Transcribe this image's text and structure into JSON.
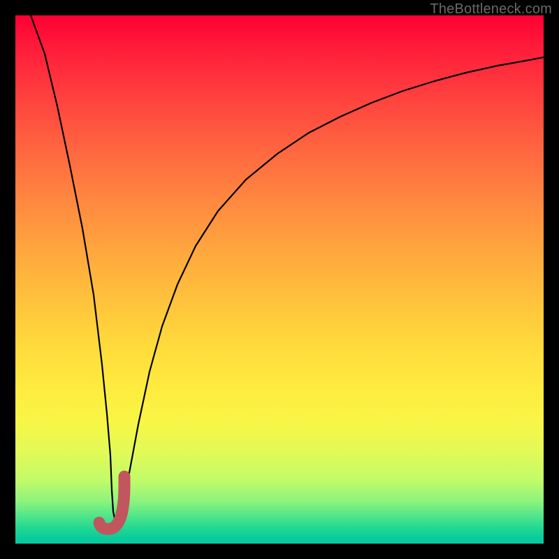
{
  "attribution": "TheBottleneck.com",
  "colors": {
    "frame": "#000000",
    "curve_stroke": "#000000",
    "marker_fill": "#c1565e",
    "gradient_top": "#ff0033",
    "gradient_bottom": "#07c9a1"
  },
  "chart_data": {
    "type": "line",
    "title": "",
    "xlabel": "",
    "ylabel": "",
    "xlim": [
      0,
      100
    ],
    "ylim": [
      0,
      100
    ],
    "grid": false,
    "legend": false,
    "series": [
      {
        "name": "curve",
        "x": [
          3,
          4,
          6,
          8,
          10,
          12,
          14,
          15,
          16,
          17,
          18,
          19,
          20,
          22,
          24,
          26,
          28,
          30,
          33,
          36,
          40,
          45,
          50,
          55,
          60,
          65,
          70,
          75,
          80,
          85,
          90,
          95,
          100
        ],
        "values": [
          100,
          92,
          79,
          66,
          54,
          41,
          28,
          22,
          15,
          8,
          4,
          2.5,
          4,
          12,
          22,
          32,
          41,
          48,
          57,
          63,
          70,
          76,
          80.5,
          84,
          86.5,
          88.5,
          90.2,
          91.5,
          92.5,
          93.3,
          94,
          94.5,
          95
        ],
        "note": "Values approximate; y read as height above bottom, 0–100 scale (top=100)."
      }
    ],
    "marker": {
      "type": "J",
      "x_range": [
        16.5,
        20.5
      ],
      "y_range": [
        2,
        11
      ]
    }
  }
}
